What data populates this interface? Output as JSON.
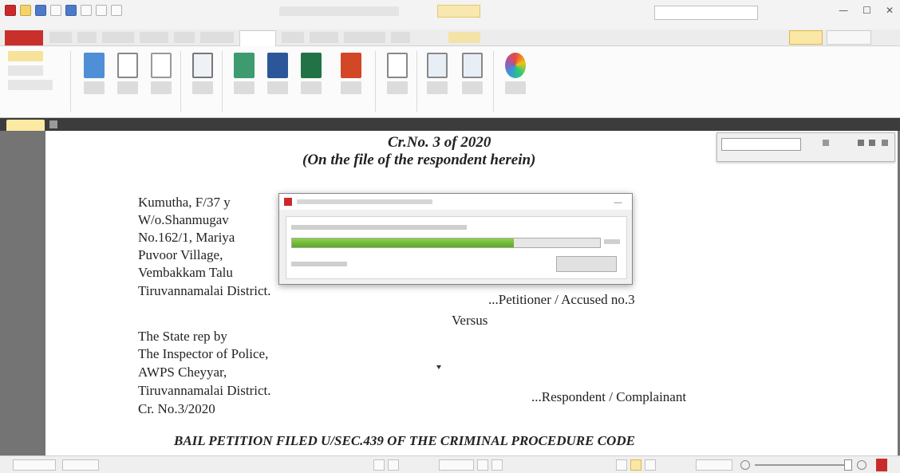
{
  "window": {
    "quick_access_icons": [
      "app-logo-icon",
      "open-folder-icon",
      "save-icon",
      "print-icon",
      "scan-icon",
      "undo-icon",
      "redo-icon",
      "dropdown-icon"
    ],
    "controls": {
      "minimize": "—",
      "maximize": "☐",
      "close": "✕"
    }
  },
  "ribbon": {
    "groups": 7,
    "buttons": [
      {
        "name": "scan",
        "icon": "scanner-icon"
      },
      {
        "name": "from-file",
        "icon": "file-icon"
      },
      {
        "name": "blank",
        "icon": "blank-page-icon"
      },
      {
        "name": "replace-pages",
        "icon": "pages-icon"
      },
      {
        "name": "export-images",
        "icon": "image-icon"
      },
      {
        "name": "to-word",
        "icon": "word-icon"
      },
      {
        "name": "to-excel",
        "icon": "excel-icon"
      },
      {
        "name": "to-powerpoint",
        "icon": "powerpoint-icon"
      },
      {
        "name": "ocr",
        "icon": "ocr-icon"
      },
      {
        "name": "enhance-scans",
        "icon": "enhance-icon"
      },
      {
        "name": "reduce-pages",
        "icon": "reduce-icon"
      },
      {
        "name": "convert-colors",
        "icon": "color-wheel-icon"
      }
    ],
    "colors": {
      "word": "#2b579a",
      "excel": "#217346",
      "powerpoint": "#d24726"
    }
  },
  "document": {
    "heading1": "Cr.No. 3 of 2020",
    "heading2": "(On the file of the respondent herein)",
    "petitioner_lines": [
      "Kumutha, F/37 y",
      "W/o.Shanmugav",
      "No.162/1, Mariya",
      "Puvoor Village,",
      "Vembakkam Talu",
      "Tiruvannamalai District."
    ],
    "petitioner_role": "...Petitioner / Accused no.3",
    "versus": "Versus",
    "respondent_lines": [
      "The State rep by",
      "The Inspector of Police,",
      "AWPS Cheyyar,",
      "Tiruvannamalai District.",
      "Cr. No.3/2020"
    ],
    "respondent_role": "...Respondent / Complainant",
    "footer_heading": "BAIL PETITION FILED U/SEC.439 OF THE CRIMINAL PROCEDURE CODE"
  },
  "ocr_dialog": {
    "progress_fraction": 0.72
  },
  "status": {
    "page_nav_icons": [
      "first-page-icon",
      "prev-page-icon",
      "next-page-icon",
      "last-page-icon"
    ],
    "zoom_icons": [
      "zoom-out-icon",
      "zoom-in-icon"
    ]
  }
}
